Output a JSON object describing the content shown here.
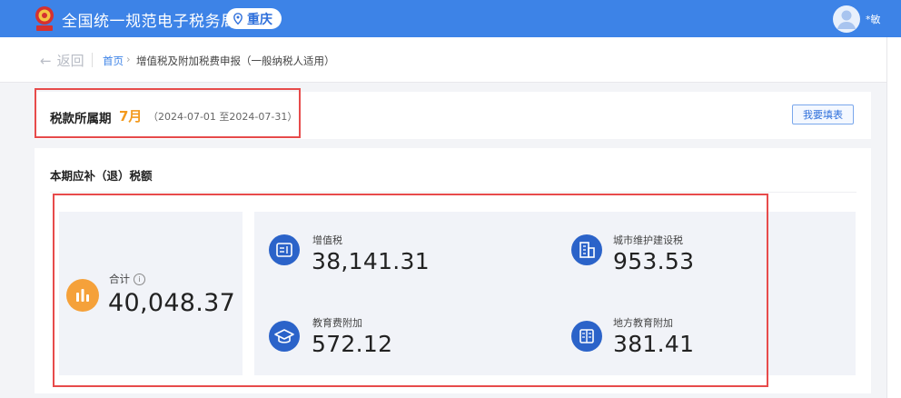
{
  "header": {
    "site_title": "全国统一规范电子税务局",
    "region": "重庆",
    "user_name": "*敏"
  },
  "breadcrumb": {
    "back_label": "返回",
    "home": "首页",
    "separator": "›",
    "current": "增值税及附加税费申报（一般纳税人适用）"
  },
  "period": {
    "label": "税款所属期",
    "month": "7月",
    "range": "（2024-07-01 至2024-07-31）",
    "fill_button": "我要填表"
  },
  "tax_section": {
    "title": "本期应补（退）税额",
    "total": {
      "label": "合计",
      "value": "40,048.37",
      "icon": "bar-chart-icon"
    },
    "items": [
      {
        "label": "增值税",
        "value": "38,141.31",
        "icon": "tax-document-icon"
      },
      {
        "label": "城市维护建设税",
        "value": "953.53",
        "icon": "building-icon"
      },
      {
        "label": "教育费附加",
        "value": "572.12",
        "icon": "graduation-cap-icon"
      },
      {
        "label": "地方教育附加",
        "value": "381.41",
        "icon": "book-icon"
      }
    ]
  },
  "colors": {
    "primary": "#3d83e7",
    "accent_orange": "#f39a1e",
    "icon_blue": "#2b63c9",
    "highlight_red": "#e74b4b"
  }
}
